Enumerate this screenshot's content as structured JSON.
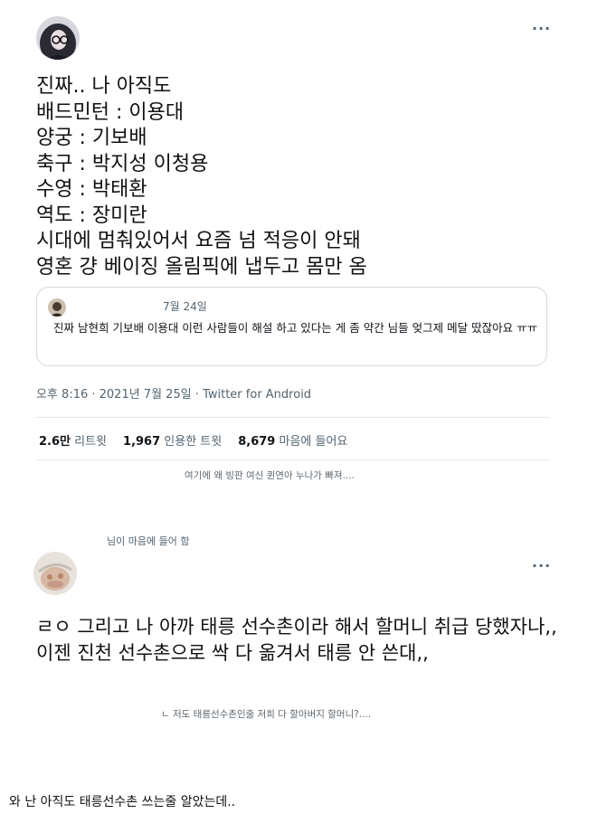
{
  "tweet1": {
    "lines": [
      "진짜.. 나 아직도",
      "배드민턴 : 이용대",
      "양궁 : 기보배",
      "축구 : 박지성 이청용",
      "수영 : 박태환",
      "역도 : 장미란",
      "시대에 멈춰있어서 요즘 넘 적응이 안돼",
      "영혼 걍 베이징 올림픽에 냅두고 몸만 옴"
    ],
    "more_label": "···",
    "quote": {
      "date": "7월 24일",
      "text": "진짜 남현희 기보배 이용대 이런 사람들이 해설 하고 있다는 게 좀 약간 님들 엊그제 메달 땄잖아요 ㅠㅠ"
    },
    "meta": "오후 8:16 · 2021년 7월 25일 · Twitter for Android",
    "stats": {
      "retweets_count": "2.6만",
      "retweets_label": "리트윗",
      "quotes_count": "1,967",
      "quotes_label": "인용한 트윗",
      "likes_count": "8,679",
      "likes_label": "마음에 들어요"
    }
  },
  "caption1": "여기에 왜 빙판 여신 퀸연아 누나가 빠져....",
  "tweet2": {
    "liked_label": "님이 마음에 들어 함",
    "more_label": "···",
    "text": "ㄹㅇ 그리고 나 아까 태릉 선수촌이라 해서 할머니 취급 당했자나,, 이젠 진천 선수촌으로 싹 다 옮겨서 태릉 안 쓴대,,"
  },
  "caption2": "ㄴ 저도 태릉선수촌인줄 저희 다 할아버지 할머니?....",
  "footer_text": "와 난 아직도 태릉선수촌 쓰는줄 알았는데..",
  "colors": {
    "text": "#0f1419",
    "secondary": "#536471",
    "border": "#cfd9de"
  }
}
